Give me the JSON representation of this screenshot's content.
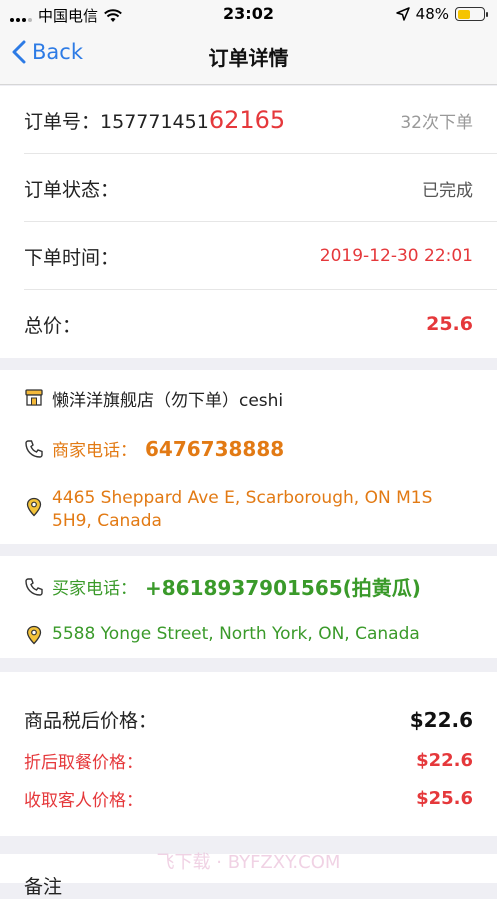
{
  "status_bar": {
    "carrier": "中国电信",
    "time": "23:02",
    "battery_percent": "48%",
    "battery_level": 0.48
  },
  "nav": {
    "back_label": "Back",
    "title": "订单详情"
  },
  "order": {
    "number_label": "订单号：",
    "number_prefix": "157771451",
    "number_suffix": "62165",
    "order_count": "32次下单",
    "status_label": "订单状态：",
    "status_value": "已完成",
    "time_label": "下单时间：",
    "time_value": "2019-12-30 22:01",
    "total_label": "总价：",
    "total_value": "25.6"
  },
  "merchant": {
    "store_name": "懒洋洋旗舰店（勿下单）ceshi",
    "phone_label": "商家电话：",
    "phone": "6476738888",
    "address": "4465 Sheppard Ave E, Scarborough, ON M1S 5H9, Canada"
  },
  "buyer": {
    "phone_label": "买家电话：",
    "phone": "+8618937901565(拍黄瓜)",
    "address": "5588 Yonge Street, North York, ON, Canada"
  },
  "pricing": {
    "after_tax_label": "商品税后价格：",
    "after_tax_value": "$22.6",
    "discount_label": "折后取餐价格：",
    "discount_value": "$22.6",
    "charge_label": "收取客人价格：",
    "charge_value": "$25.6"
  },
  "notes": {
    "label": "备注"
  },
  "watermark": "飞下载 · BYFZXY.COM",
  "colors": {
    "accent_blue": "#2d7be5",
    "red": "#e5383b",
    "orange": "#e27a14",
    "green": "#3a9a2a"
  }
}
